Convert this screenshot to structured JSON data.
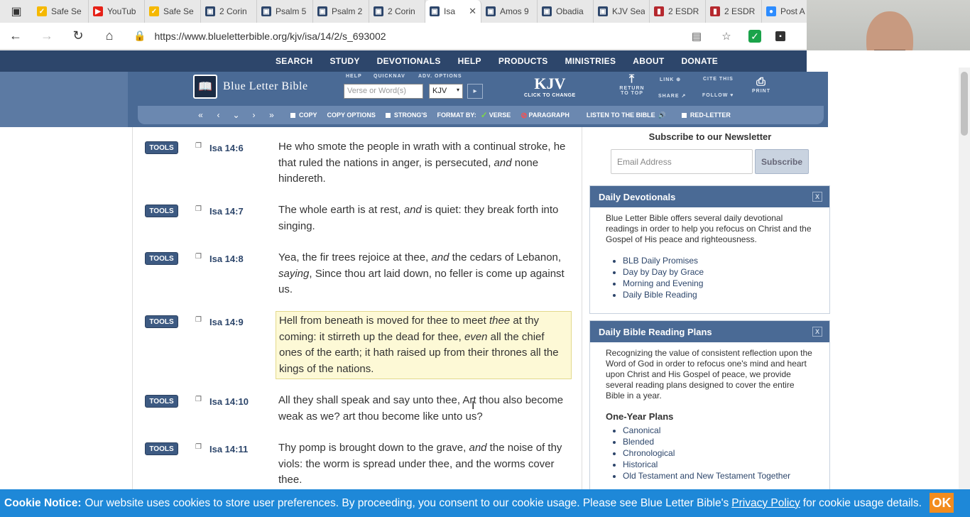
{
  "browser": {
    "tabs": [
      {
        "title": "Safe Se",
        "icon": "checkmark-icon",
        "color": "#f5b800"
      },
      {
        "title": "YouTub",
        "icon": "youtube-icon",
        "color": "#e62117"
      },
      {
        "title": "Safe Se",
        "icon": "checkmark-icon",
        "color": "#f5b800"
      },
      {
        "title": "2 Corin",
        "icon": "blb-icon",
        "color": "#2d466b"
      },
      {
        "title": "Psalm 5",
        "icon": "blb-icon",
        "color": "#2d466b"
      },
      {
        "title": "Psalm 2",
        "icon": "blb-icon",
        "color": "#2d466b"
      },
      {
        "title": "2 Corin",
        "icon": "blb-icon",
        "color": "#2d466b"
      },
      {
        "title": "Isa",
        "icon": "blb-icon",
        "color": "#2d466b",
        "active": true
      },
      {
        "title": "Amos 9",
        "icon": "blb-icon",
        "color": "#2d466b"
      },
      {
        "title": "Obadia",
        "icon": "blb-icon",
        "color": "#2d466b"
      },
      {
        "title": "KJV Sea",
        "icon": "blb-icon",
        "color": "#2d466b"
      },
      {
        "title": "2 ESDR",
        "icon": "book-icon",
        "color": "#b5282e"
      },
      {
        "title": "2 ESDR",
        "icon": "book-icon",
        "color": "#b5282e"
      },
      {
        "title": "Post A",
        "icon": "zoom-icon",
        "color": "#2d8cff"
      }
    ],
    "url": "https://www.blueletterbible.org/kjv/isa/14/2/s_693002"
  },
  "site": {
    "nav": [
      "SEARCH",
      "STUDY",
      "DEVOTIONALS",
      "HELP",
      "PRODUCTS",
      "MINISTRIES",
      "ABOUT",
      "DONATE"
    ],
    "logo_text": "Blue Letter Bible",
    "header_labels": {
      "help": "HELP",
      "quicknav": "QUICKNAV",
      "adv": "ADV. OPTIONS"
    },
    "search_placeholder": "Verse or Word(s)",
    "version_value": "KJV",
    "kjv_big": "KJV",
    "kjv_small": "CLICK TO CHANGE",
    "return_top": "RETURN TO TOP",
    "link": "LINK",
    "share": "SHARE",
    "cite": "CITE THIS",
    "follow": "FOLLOW",
    "print": "PRINT",
    "tools_bar": {
      "copy": "COPY",
      "copy_options": "COPY OPTIONS",
      "strongs": "STRONG'S",
      "format_by": "FORMAT BY:",
      "verse": "VERSE",
      "paragraph": "PARAGRAPH",
      "listen": "LISTEN TO THE BIBLE",
      "red_letter": "RED-LETTER"
    }
  },
  "verses": [
    {
      "tools": "TOOLS",
      "ref": "Isa 14:6",
      "html": "He who smote the people in wrath with a continual stroke, he that ruled the nations in anger, is persecuted, <i>and</i> none hindereth."
    },
    {
      "tools": "TOOLS",
      "ref": "Isa 14:7",
      "html": "The whole earth is at rest, <i>and</i> is quiet: they break forth into singing."
    },
    {
      "tools": "TOOLS",
      "ref": "Isa 14:8",
      "html": "Yea, the fir trees rejoice at thee, <i>and</i> the cedars of Lebanon, <i>saying</i>, Since thou art laid down, no feller is come up against us."
    },
    {
      "tools": "TOOLS",
      "ref": "Isa 14:9",
      "html": "Hell from beneath is moved for thee to meet <i>thee</i> at thy coming: it stirreth up the dead for thee, <i>even</i> all the chief ones of the earth; it hath raised up from their thrones all the kings of the nations.",
      "highlight": true
    },
    {
      "tools": "TOOLS",
      "ref": "Isa 14:10",
      "html": "All they shall speak and say unto thee, Art thou also become weak as we? art thou become like unto us?"
    },
    {
      "tools": "TOOLS",
      "ref": "Isa 14:11",
      "html": "Thy pomp is brought down to the grave, <i>and</i> the noise of thy viols: the worm is spread under thee, and the worms cover thee."
    }
  ],
  "sidebar": {
    "newsletter_title": "Subscribe to our Newsletter",
    "email_placeholder": "Email Address",
    "subscribe_label": "Subscribe",
    "devotionals": {
      "title": "Daily Devotionals",
      "close": "X",
      "body": "Blue Letter Bible offers several daily devotional readings in order to help you refocus on Christ and the Gospel of His peace and righteousness.",
      "links": [
        "BLB Daily Promises",
        "Day by Day by Grace",
        "Morning and Evening",
        "Daily Bible Reading"
      ]
    },
    "plans": {
      "title": "Daily Bible Reading Plans",
      "close": "X",
      "body": "Recognizing the value of consistent reflection upon the Word of God in order to refocus one's mind and heart upon Christ and His Gospel of peace, we provide several reading plans designed to cover the entire Bible in a year.",
      "subheading": "One-Year Plans",
      "links": [
        "Canonical",
        "Blended",
        "Chronological",
        "Historical",
        "Old Testament and New Testament Together"
      ]
    }
  },
  "cookie": {
    "label": "Cookie Notice:",
    "text": "Our website uses cookies to store user preferences. By proceeding, you consent to our cookie usage. Please see Blue Letter Bible's",
    "link": "Privacy Policy",
    "tail": "for cookie usage details.",
    "ok": "OK"
  }
}
